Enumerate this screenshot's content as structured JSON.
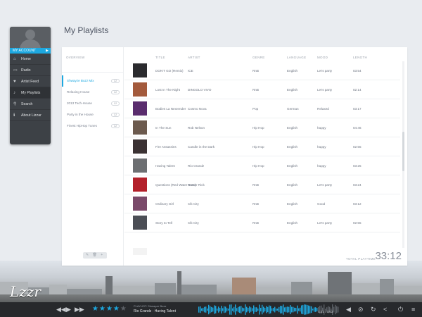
{
  "page_title": "My Playlists",
  "sidebar": {
    "account_label": "MY ACCOUNT",
    "items": [
      {
        "label": "Home",
        "icon": "home-icon",
        "glyph": "⌂"
      },
      {
        "label": "Radio",
        "icon": "radio-icon",
        "glyph": "▭"
      },
      {
        "label": "Artist Feed",
        "icon": "heart-icon",
        "glyph": "♥"
      },
      {
        "label": "My Playlists",
        "icon": "music-note-icon",
        "glyph": "♪"
      },
      {
        "label": "Search",
        "icon": "search-icon",
        "glyph": "⚲"
      },
      {
        "label": "About Lizzar",
        "icon": "info-icon",
        "glyph": "ℹ"
      }
    ]
  },
  "overview": {
    "header": "OVERVIEW",
    "playlists": [
      {
        "name": "Shwayze Buzz Mix",
        "count": "12",
        "active": true
      },
      {
        "name": "Relaxing House",
        "count": "12",
        "active": false
      },
      {
        "name": "2013 Tech-House",
        "count": "12",
        "active": false
      },
      {
        "name": "Party in the House",
        "count": "12",
        "active": false
      },
      {
        "name": "Finest HipHop Tunes",
        "count": "12",
        "active": false
      }
    ],
    "tools": "✎ 🗑 +"
  },
  "columns": {
    "title": "TITLE",
    "artist": "ARTIST",
    "genre": "GENRE",
    "language": "LANGUAGE",
    "mood": "MOOD",
    "length": "LENGTH"
  },
  "tracks": [
    {
      "title": "DON'T GO (Remix)",
      "artist": "ICE",
      "genre": "RnB",
      "language": "English",
      "mood": "Let's party",
      "length": "03:54",
      "color": "#2b2b2e"
    },
    {
      "title": "Lost In The Night",
      "artist": "DINGOLO VIVO",
      "genre": "RnB",
      "language": "English",
      "mood": "Let's party",
      "length": "02:14",
      "color": "#a35a3c"
    },
    {
      "title": "Bodies La Nexrender",
      "artist": "Cosmo Nova",
      "genre": "Pop",
      "language": "German",
      "mood": "Relaxed",
      "length": "03:17",
      "color": "#5a2d6e"
    },
    {
      "title": "In The Sun",
      "artist": "Rob Nelson",
      "genre": "Hip Hop",
      "language": "English",
      "mood": "happy",
      "length": "04:46",
      "color": "#6c5a4e"
    },
    {
      "title": "Fire Assassins",
      "artist": "Candle in the Dark",
      "genre": "Hip Hop",
      "language": "English",
      "mood": "happy",
      "length": "02:55",
      "color": "#3b3233"
    },
    {
      "title": "Having Talent",
      "artist": "Rio Grandz",
      "genre": "Hip Hop",
      "language": "English",
      "mood": "happy",
      "length": "03:25",
      "color": "#6d6f72"
    },
    {
      "title": "Questions (Red Water Intro)",
      "artist": "Raster Rick",
      "genre": "RnB",
      "language": "English",
      "mood": "Let's party",
      "length": "03:24",
      "color": "#b3202a"
    },
    {
      "title": "Ordinary Girl",
      "artist": "Clk City",
      "genre": "RnB",
      "language": "English",
      "mood": "Good",
      "length": "03:12",
      "color": "#7a4a6a"
    },
    {
      "title": "Story to Tell",
      "artist": "Clk City",
      "genre": "RnB",
      "language": "English",
      "mood": "Let's party",
      "length": "02:55",
      "color": "#4b4e55"
    }
  ],
  "total": {
    "label": "TOTAL PLAYTIME",
    "time": "33:12"
  },
  "player": {
    "logo": "Lzzr",
    "rating": 4,
    "now_playing_label": "PLAYLIST: Shwayze Buzz",
    "artist": "Rio Grandz",
    "song": "Having Talent",
    "time": "1:21 / 3:53",
    "accent": "#1da8e0"
  }
}
